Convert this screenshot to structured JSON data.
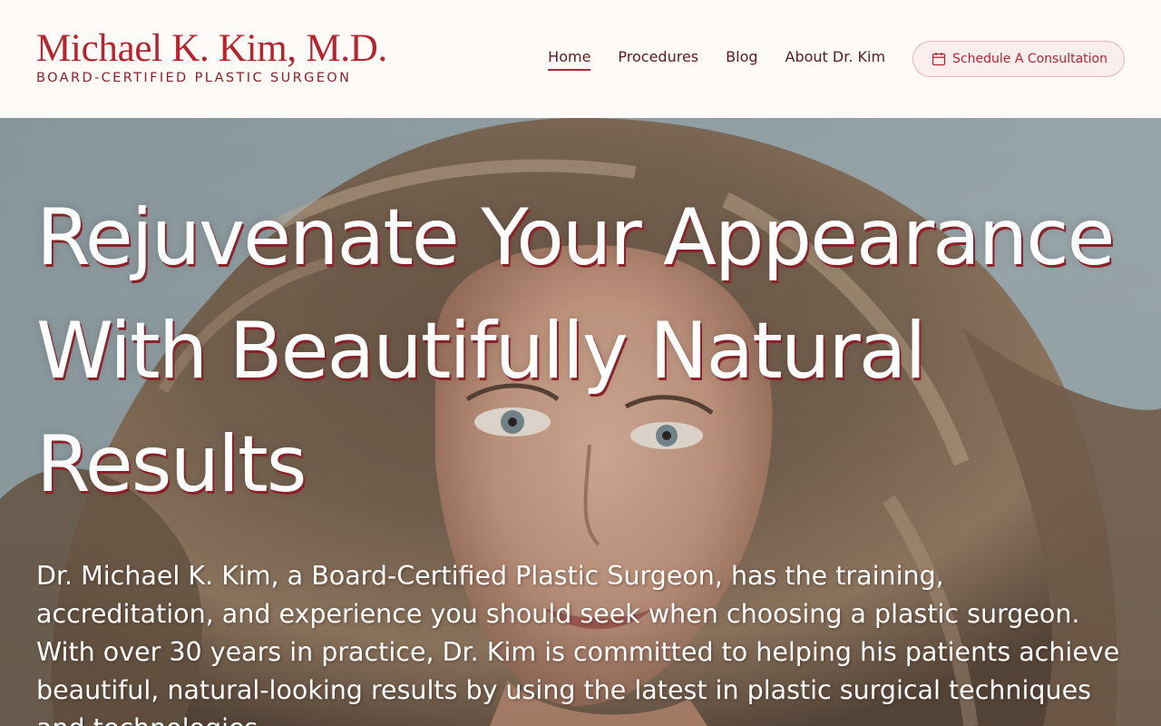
{
  "brand": {
    "name": "Michael K. Kim, M.D.",
    "tagline": "BOARD-CERTIFIED PLASTIC SURGEON",
    "primary_color": "#b3262e"
  },
  "nav": {
    "items": [
      {
        "label": "Home",
        "active": true
      },
      {
        "label": "Procedures",
        "active": false
      },
      {
        "label": "Blog",
        "active": false
      },
      {
        "label": "About Dr. Kim",
        "active": false
      }
    ],
    "cta": {
      "label": "Schedule A Consultation",
      "icon": "calendar-icon"
    }
  },
  "hero": {
    "title": "Rejuvenate Your Appearance With Beautifully Natural Results",
    "description": "Dr. Michael K. Kim, a Board-Certified Plastic Surgeon, has the training, accreditation, and experience you should seek when choosing a plastic surgeon. With over 30 years in practice, Dr. Kim is committed to helping his patients achieve beautiful, natural-looking results by using the latest in plastic surgical techniques and technologies."
  }
}
